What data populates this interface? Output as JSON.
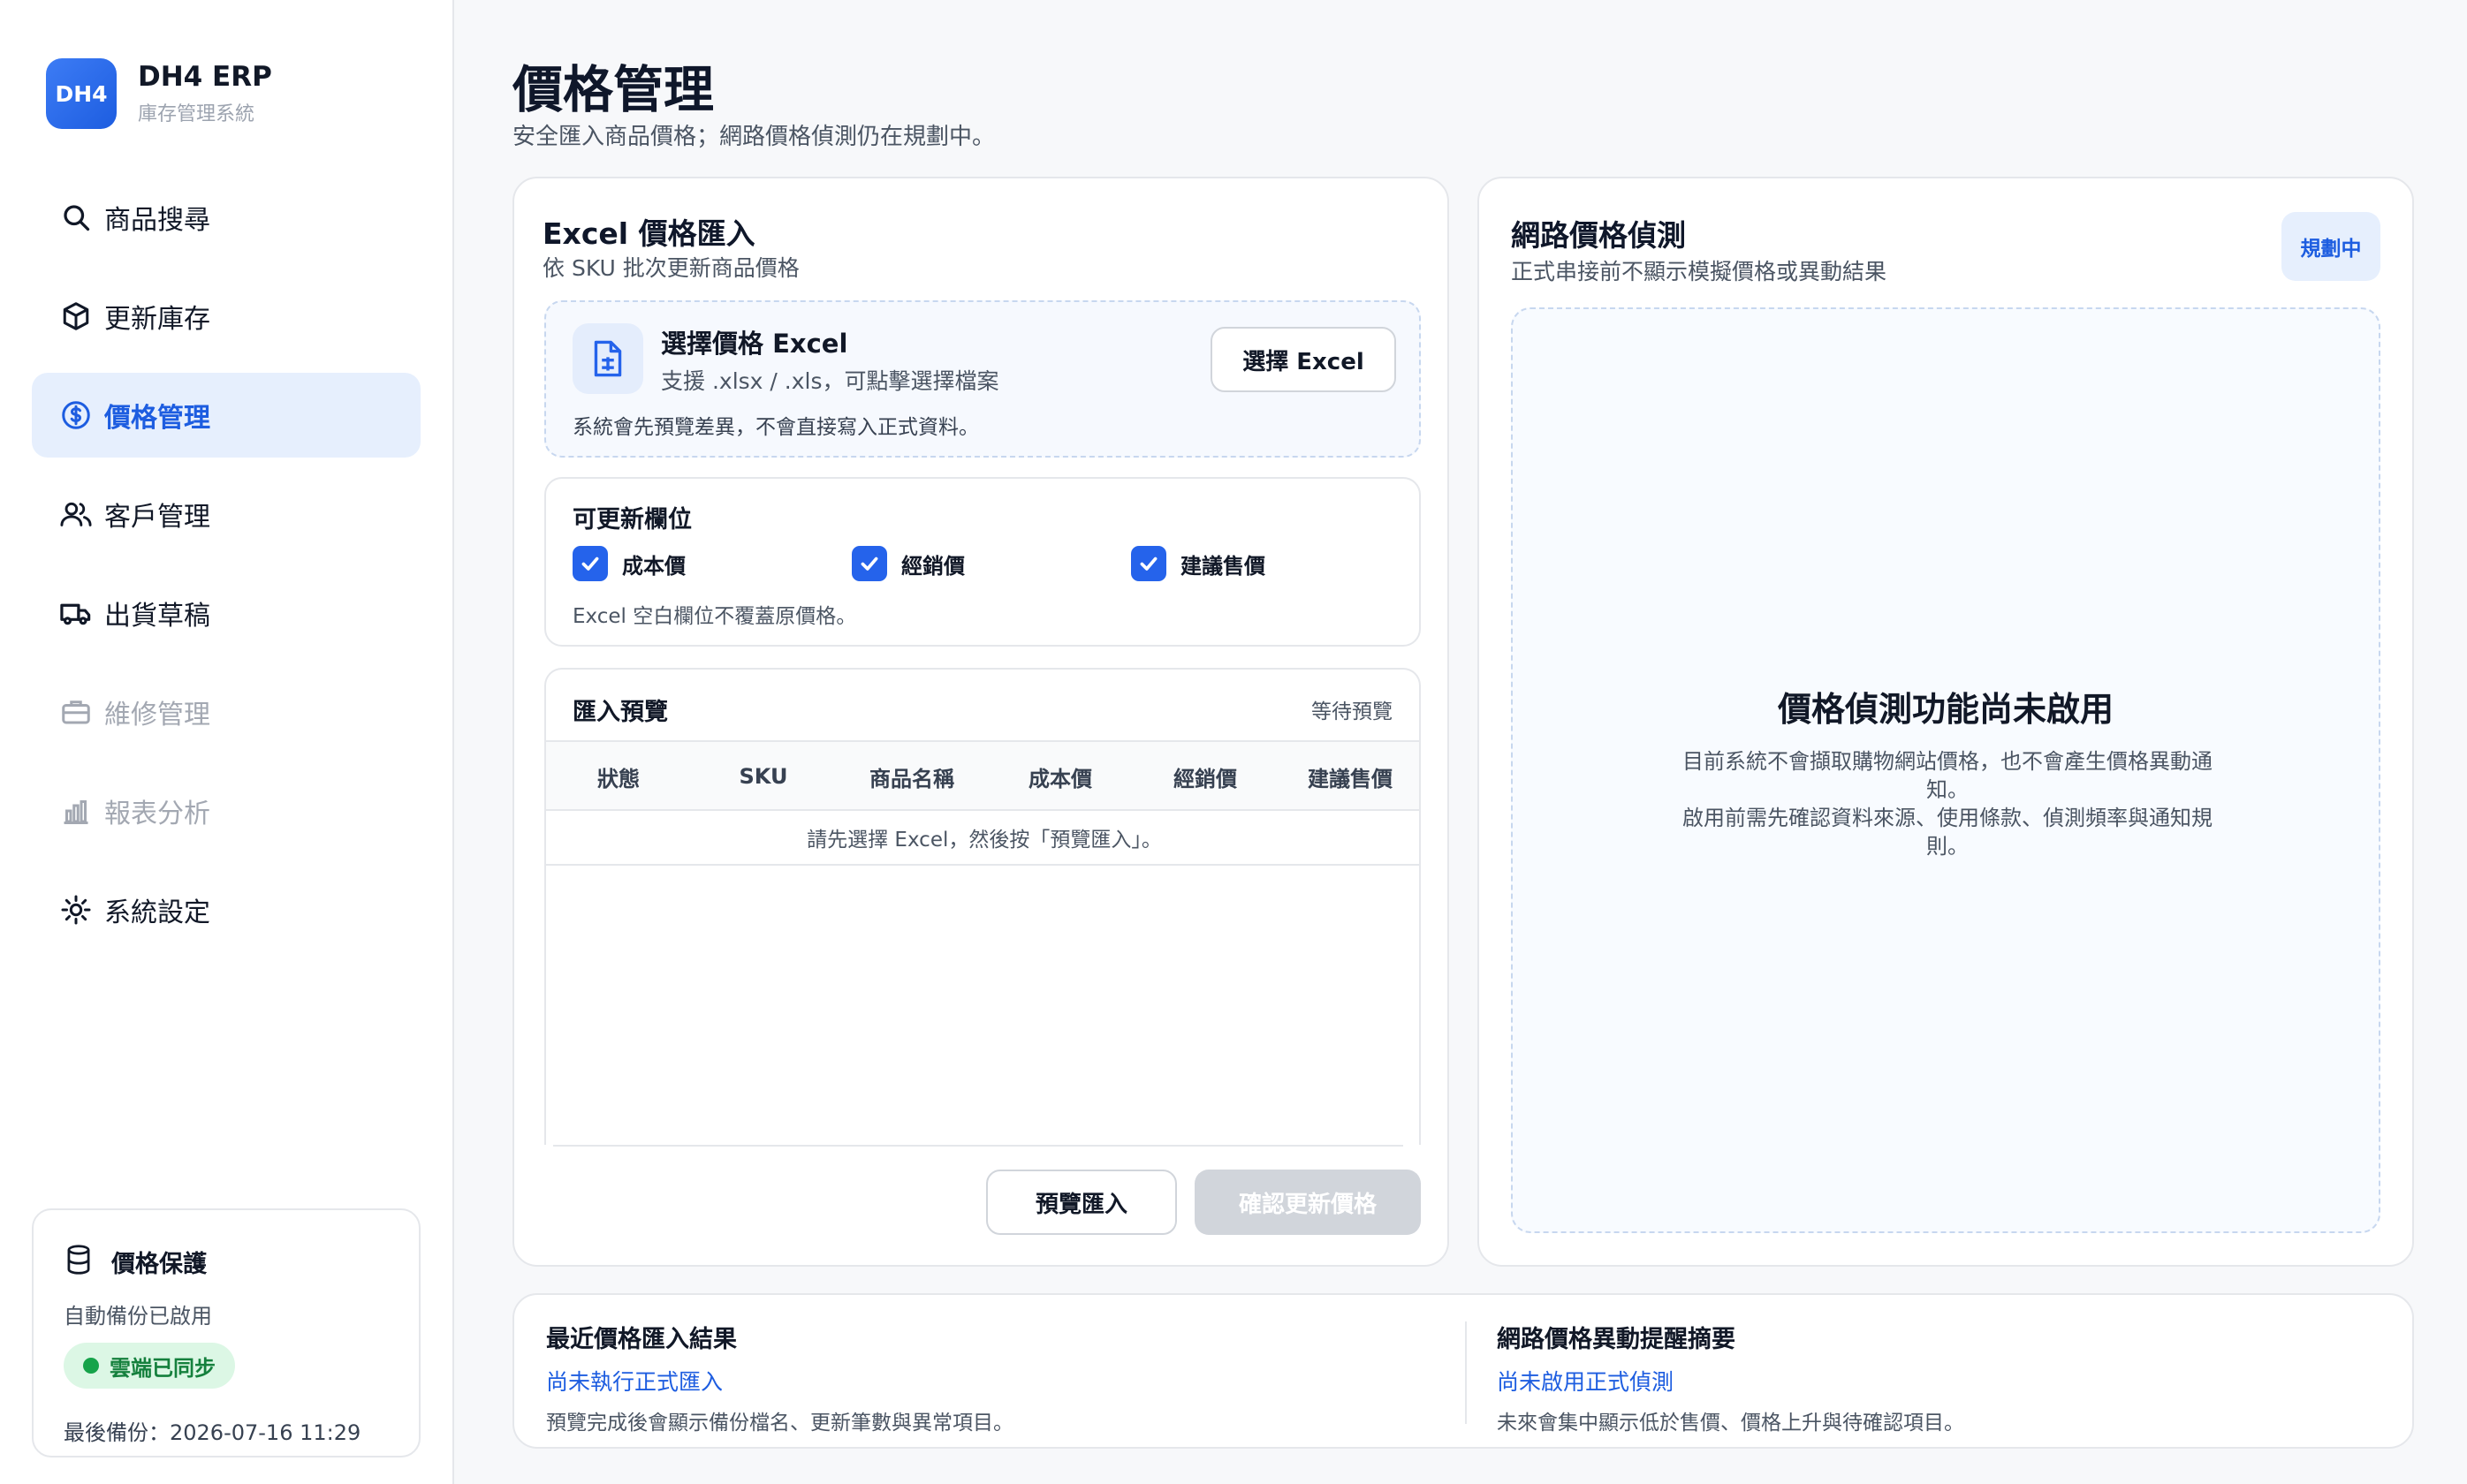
{
  "brand": {
    "logo": "DH4",
    "name": "DH4 ERP",
    "subtitle": "庫存管理系統"
  },
  "nav": [
    {
      "label": "商品搜尋",
      "icon": "search-icon",
      "state": "normal"
    },
    {
      "label": "更新庫存",
      "icon": "box-icon",
      "state": "normal"
    },
    {
      "label": "價格管理",
      "icon": "dollar-icon",
      "state": "active"
    },
    {
      "label": "客戶管理",
      "icon": "users-icon",
      "state": "normal"
    },
    {
      "label": "出貨草稿",
      "icon": "truck-icon",
      "state": "normal"
    },
    {
      "label": "維修管理",
      "icon": "briefcase-icon",
      "state": "disabled"
    },
    {
      "label": "報表分析",
      "icon": "chart-icon",
      "state": "disabled"
    },
    {
      "label": "系統設定",
      "icon": "gear-icon",
      "state": "normal"
    }
  ],
  "protect": {
    "title": "價格保護",
    "subtitle": "自動備份已啟用",
    "sync": "雲端已同步",
    "last_backup": "最後備份：2026-07-16 11:29"
  },
  "page": {
    "title": "價格管理",
    "subtitle": "安全匯入商品價格；網路價格偵測仍在規劃中。"
  },
  "excel": {
    "title": "Excel 價格匯入",
    "subtitle": "依 SKU 批次更新商品價格",
    "file_title": "選擇價格 Excel",
    "file_sub": "支援 .xlsx / .xls，可點擊選擇檔案",
    "file_note": "系統會先預覽差異，不會直接寫入正式資料。",
    "choose_btn": "選擇 Excel",
    "fields_title": "可更新欄位",
    "fields": [
      {
        "label": "成本價",
        "checked": true
      },
      {
        "label": "經銷價",
        "checked": true
      },
      {
        "label": "建議售價",
        "checked": true
      }
    ],
    "fields_note": "Excel 空白欄位不覆蓋原價格。",
    "preview_title": "匯入預覽",
    "preview_status": "等待預覽",
    "columns": [
      "狀態",
      "SKU",
      "商品名稱",
      "成本價",
      "經銷價",
      "建議售價"
    ],
    "empty_text": "請先選擇 Excel，然後按「預覽匯入」。",
    "preview_btn": "預覽匯入",
    "confirm_btn": "確認更新價格"
  },
  "web": {
    "title": "網路價格偵測",
    "subtitle": "正式串接前不顯示模擬價格或異動結果",
    "badge": "規劃中",
    "heading": "價格偵測功能尚未啟用",
    "desc1": "目前系統不會擷取購物網站價格，也不會產生價格異動通知。",
    "desc2": "啟用前需先確認資料來源、使用條款、偵測頻率與通知規則。"
  },
  "summary": {
    "left": {
      "title": "最近價格匯入結果",
      "link": "尚未執行正式匯入",
      "note": "預覽完成後會顯示備份檔名、更新筆數與異常項目。"
    },
    "right": {
      "title": "網路價格異動提醒摘要",
      "link": "尚未啟用正式偵測",
      "note": "未來會集中顯示低於售價、價格上升與待確認項目。"
    }
  },
  "colors": {
    "accent": "#1d5de0",
    "active_bg": "#e6effd",
    "success": "#16a34a"
  }
}
